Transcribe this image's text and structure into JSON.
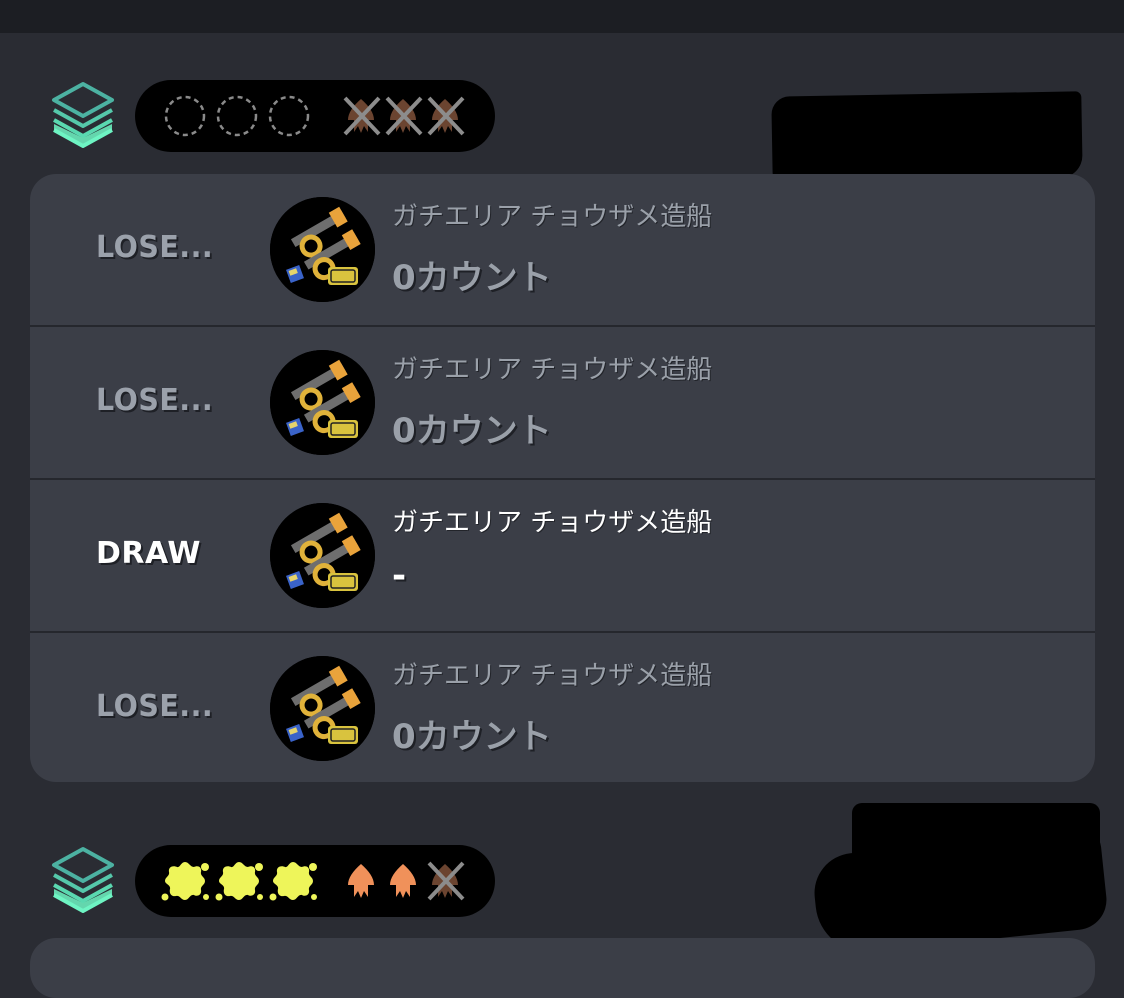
{
  "groups": [
    {
      "mode_icon": "splat-zones-layers-icon",
      "wins_icons": [
        "empty-circle-icon",
        "empty-circle-icon",
        "empty-circle-icon"
      ],
      "losses_icons": [
        "crossed-squid-icon",
        "crossed-squid-icon",
        "crossed-squid-icon"
      ],
      "matches": [
        {
          "result": "LOSE...",
          "weapon_icon": "splatling-weapon-icon",
          "stage": "ガチエリア チョウザメ造船",
          "count": "0カウント",
          "style": "lose"
        },
        {
          "result": "LOSE...",
          "weapon_icon": "splatling-weapon-icon",
          "stage": "ガチエリア チョウザメ造船",
          "count": "0カウント",
          "style": "lose"
        },
        {
          "result": "DRAW",
          "weapon_icon": "splatling-weapon-icon",
          "stage": "ガチエリア チョウザメ造船",
          "count": "-",
          "style": "draw"
        },
        {
          "result": "LOSE...",
          "weapon_icon": "splatling-weapon-icon",
          "stage": "ガチエリア チョウザメ造船",
          "count": "0カウント",
          "style": "lose"
        }
      ]
    },
    {
      "mode_icon": "splat-zones-layers-icon",
      "wins_icons": [
        "yellow-splat-icon",
        "yellow-splat-icon",
        "yellow-splat-icon"
      ],
      "losses_icons": [
        "orange-squid-icon",
        "orange-squid-icon",
        "crossed-squid-icon"
      ]
    }
  ],
  "colors": {
    "background": "#2a2c33",
    "card": "#3b3e47",
    "lose_text": "#9ba1ab",
    "draw_text": "#ffffff",
    "win_splat": "#eef55a",
    "squid_orange": "#f0915a",
    "squid_crossed": "#6b4430",
    "zones_green": "#5ee3b2"
  }
}
